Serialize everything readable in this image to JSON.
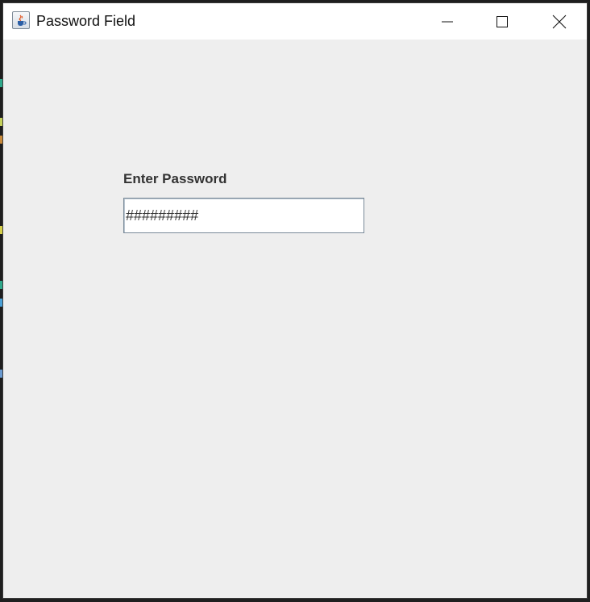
{
  "window": {
    "title": "Password Field",
    "app_icon": "java-cup-icon",
    "controls": {
      "minimize_icon": "minimize-icon",
      "maximize_icon": "maximize-icon",
      "close_icon": "close-icon"
    }
  },
  "form": {
    "label": "Enter Password",
    "password_value": "#########"
  },
  "colors": {
    "background": "#eeeeee",
    "titlebar": "#ffffff",
    "label_text": "#333333",
    "input_border": "#7a8a99"
  }
}
